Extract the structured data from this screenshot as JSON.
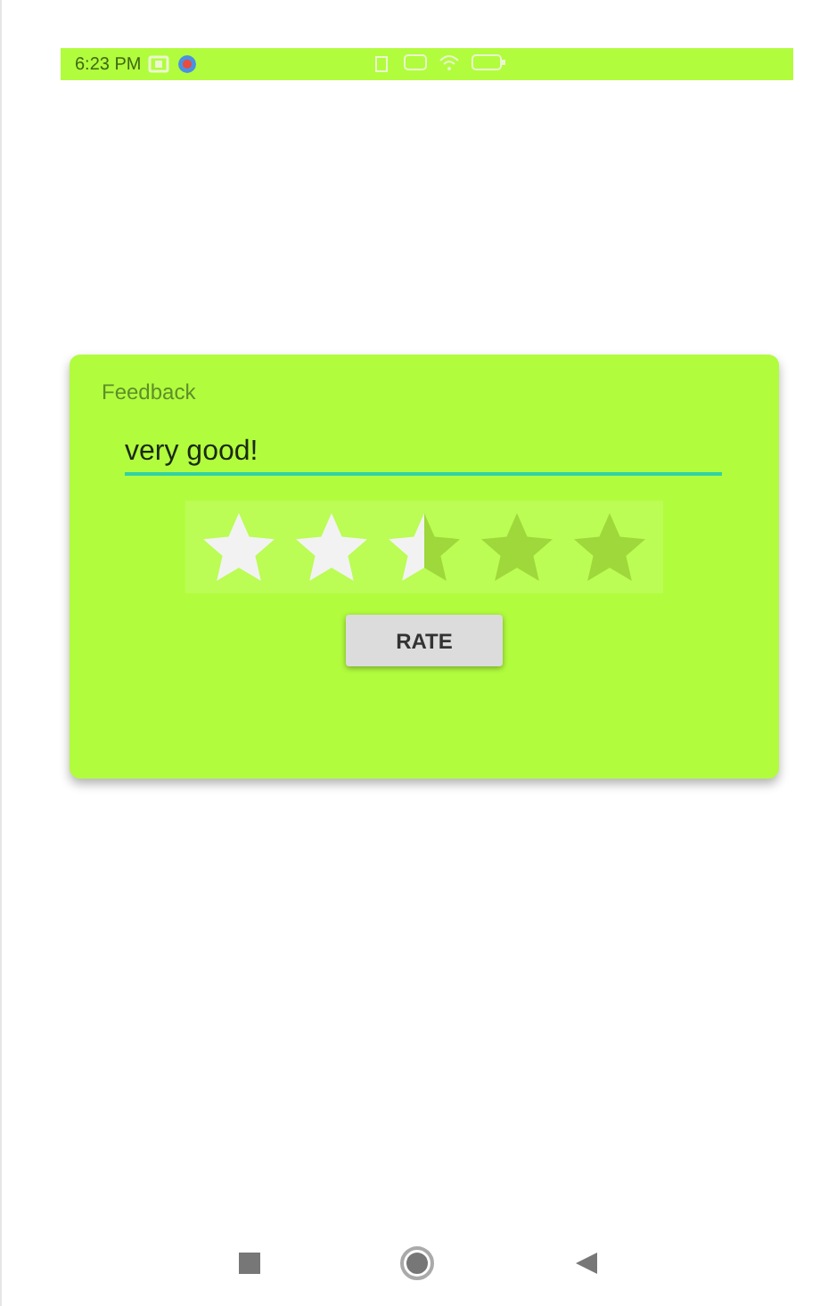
{
  "status_bar": {
    "time": "6:23 PM"
  },
  "card": {
    "title": "Feedback",
    "comment": {
      "value": "very good!"
    },
    "rating": {
      "stars": 2.5
    },
    "button": "RATE"
  }
}
